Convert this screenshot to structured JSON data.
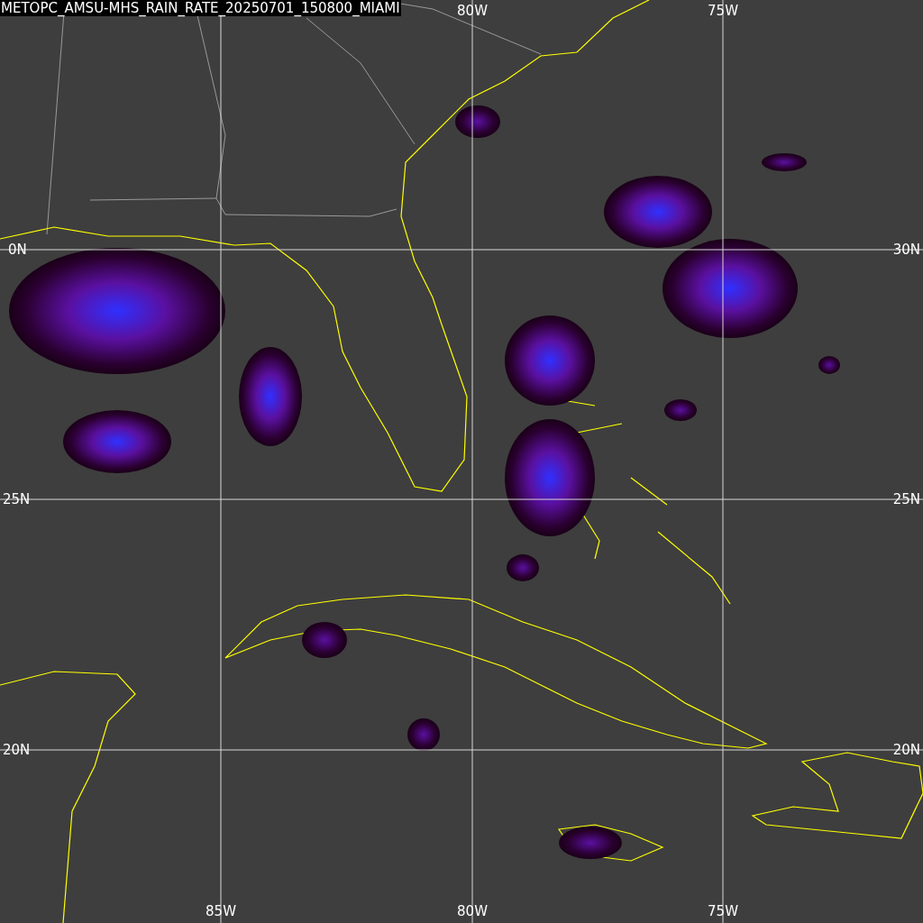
{
  "title": "METOPC_AMSU-MHS_RAIN_RATE_20250701_150800_MIAMI",
  "top_labels": [
    "80W",
    "75W"
  ],
  "bottom_labels": [
    "85W",
    "80W",
    "75W"
  ],
  "left_labels": [
    "0N",
    "25N",
    "20N"
  ],
  "right_labels": [
    "30N",
    "25N",
    "20N"
  ]
}
